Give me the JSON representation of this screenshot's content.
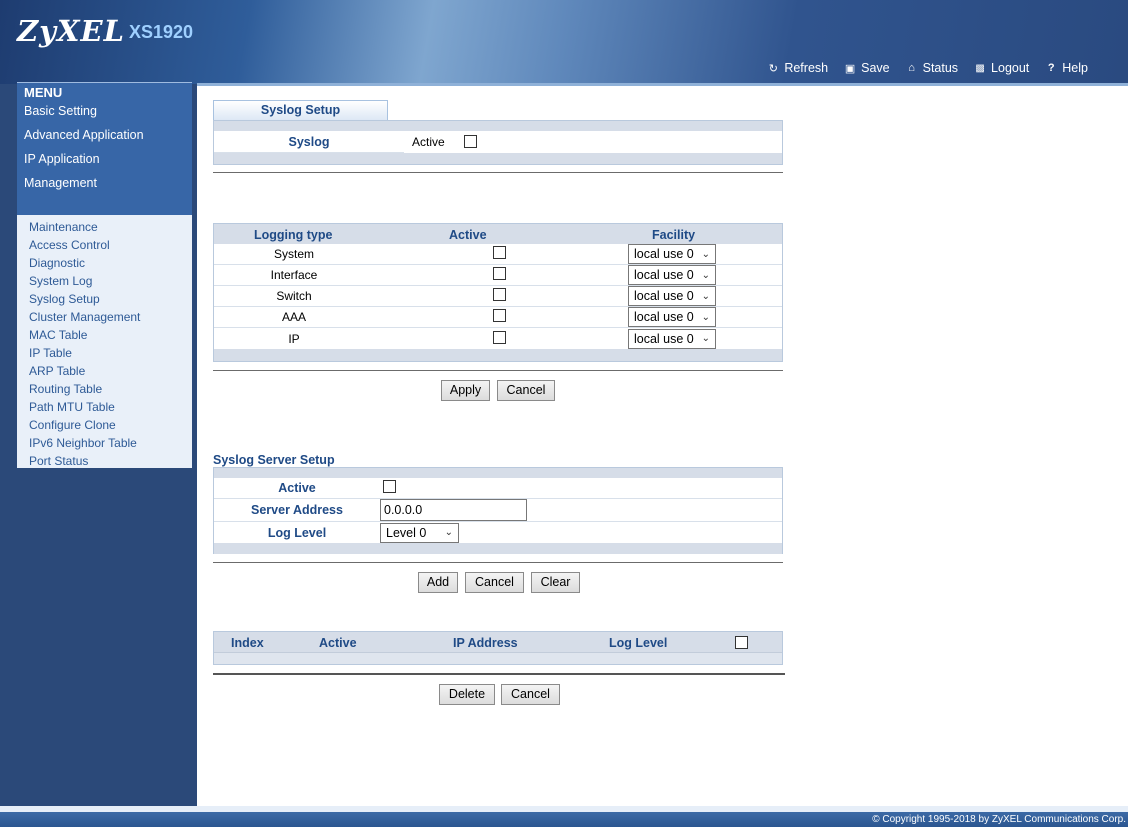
{
  "header": {
    "brand": "ZyXEL",
    "model": "XS1920",
    "links": [
      {
        "label": "Refresh",
        "icon": "refresh-icon",
        "glyph": "↻"
      },
      {
        "label": "Save",
        "icon": "save-icon",
        "glyph": "▣"
      },
      {
        "label": "Status",
        "icon": "home-icon",
        "glyph": "⌂"
      },
      {
        "label": "Logout",
        "icon": "lock-icon",
        "glyph": "🔒"
      },
      {
        "label": "Help",
        "icon": "help-icon",
        "glyph": "?"
      }
    ]
  },
  "sidebar": {
    "title": "MENU",
    "menu": [
      "Basic Setting",
      "Advanced Application",
      "IP Application",
      "Management"
    ],
    "submenu": [
      "Maintenance",
      "Access Control",
      "Diagnostic",
      "System Log",
      "Syslog Setup",
      "Cluster Management",
      "MAC Table",
      "IP Table",
      "ARP Table",
      "Routing Table",
      "Path MTU Table",
      "Configure Clone",
      "IPv6 Neighbor Table",
      "Port Status"
    ]
  },
  "syslog_setup": {
    "tab": "Syslog Setup",
    "label": "Syslog",
    "active_label": "Active"
  },
  "logging": {
    "headers": {
      "type": "Logging type",
      "active": "Active",
      "facility": "Facility"
    },
    "rows": [
      {
        "type": "System",
        "facility": "local use 0"
      },
      {
        "type": "Interface",
        "facility": "local use 0"
      },
      {
        "type": "Switch",
        "facility": "local use 0"
      },
      {
        "type": "AAA",
        "facility": "local use 0"
      },
      {
        "type": "IP",
        "facility": "local use 0"
      }
    ],
    "apply": "Apply",
    "cancel": "Cancel"
  },
  "server_setup": {
    "title": "Syslog Server Setup",
    "active_label": "Active",
    "address_label": "Server Address",
    "address_value": "0.0.0.0",
    "level_label": "Log Level",
    "level_value": "Level 0",
    "add": "Add",
    "cancel": "Cancel",
    "clear": "Clear"
  },
  "server_table": {
    "headers": {
      "index": "Index",
      "active": "Active",
      "ip": "IP Address",
      "level": "Log Level"
    },
    "delete": "Delete",
    "cancel": "Cancel"
  },
  "footer": {
    "copyright": "© Copyright 1995-2018 by ZyXEL Communications Corp."
  }
}
